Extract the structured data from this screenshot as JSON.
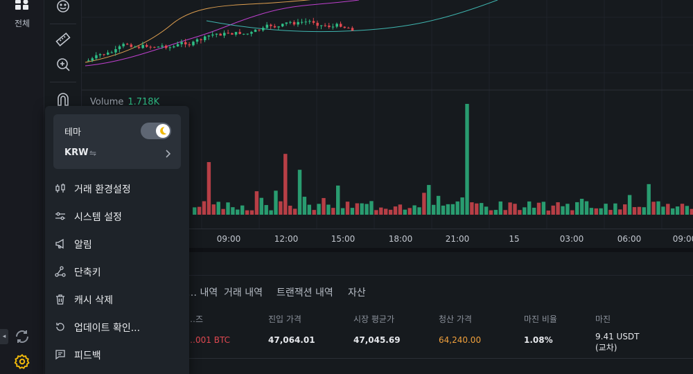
{
  "rail": {
    "all_label": "전체"
  },
  "chart": {
    "volume_label": "Volume",
    "volume_value": "1.718K",
    "time_labels": [
      "09:00",
      "12:00",
      "15:00",
      "18:00",
      "21:00",
      "15",
      "03:00",
      "06:00",
      "09:00"
    ],
    "colors": {
      "up": "#2ebd85",
      "down": "#e04850",
      "ma_fast": "#e0a050",
      "ma_mid": "#c040d0",
      "ma_slow": "#3fb6b0"
    }
  },
  "bottom": {
    "tabs": [
      "… 내역",
      "거래 내역",
      "트랜잭션 내역",
      "자산"
    ],
    "headers": [
      "…즈",
      "진입 가격",
      "시장 평균가",
      "청산 가격",
      "마진 비율",
      "마진"
    ],
    "row": {
      "size": "…001 BTC",
      "entry_price": "47,064.01",
      "mark_price": "47,045.69",
      "liq_price": "64,240.00",
      "margin_ratio": "1.08%",
      "margin_value": "9.41 USDT",
      "margin_mode": "(교차)"
    }
  },
  "menu": {
    "theme_label": "테마",
    "theme_dark": true,
    "currency_label": "KRW",
    "currency_swap_icon": "⇋",
    "items": [
      {
        "label": "거래 환경설정",
        "icon": "candlestick-icon"
      },
      {
        "label": "시스템 설정",
        "icon": "sliders-icon"
      },
      {
        "label": "알림",
        "icon": "megaphone-icon"
      },
      {
        "label": "단축키",
        "icon": "shortcut-icon"
      },
      {
        "label": "캐시 삭제",
        "icon": "trash-icon"
      },
      {
        "label": "업데이트 확인...",
        "icon": "refresh-icon"
      },
      {
        "label": "피드백",
        "icon": "feedback-icon"
      }
    ]
  }
}
